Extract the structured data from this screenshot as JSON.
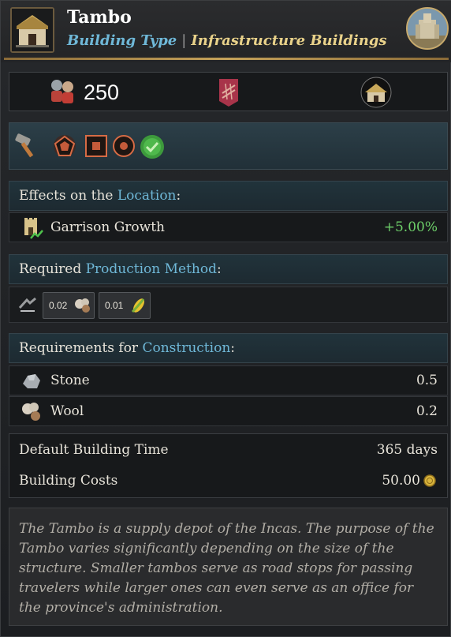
{
  "header": {
    "title": "Tambo",
    "type_label": "Building Type",
    "separator": "|",
    "category": "Infrastructure Buildings",
    "icon": "tambo-building-icon",
    "portrait_icon": "castle-portrait-icon"
  },
  "stats": {
    "population_icon": "pops-icon",
    "population": "250",
    "road_icon": "road-icon",
    "building_icon": "hut-icon"
  },
  "tech": {
    "icons": [
      "hammer-icon",
      "pentagon-icon",
      "square-icon",
      "circle-icon",
      "checkmark-icon"
    ]
  },
  "effects": {
    "header_prefix": "Effects on the ",
    "header_link": "Location",
    "header_suffix": ":",
    "rows": [
      {
        "icon": "garrison-icon",
        "label": "Garrison Growth",
        "value": "+5.00%"
      }
    ]
  },
  "production": {
    "header_prefix": "Required ",
    "header_link": "Production Method",
    "header_suffix": ":",
    "items": [
      {
        "amount": "0.02",
        "icon": "wool-icon"
      },
      {
        "amount": "0.01",
        "icon": "maize-icon"
      }
    ]
  },
  "construction": {
    "header_prefix": "Requirements for ",
    "header_link": "Construction",
    "header_suffix": ":",
    "rows": [
      {
        "icon": "stone-icon",
        "label": "Stone",
        "value": "0.5"
      },
      {
        "icon": "wool-icon",
        "label": "Wool",
        "value": "0.2"
      }
    ]
  },
  "info": {
    "time_label": "Default Building Time",
    "time_value": "365 days",
    "cost_label": "Building Costs",
    "cost_value": "50.00",
    "cost_icon": "gold-coin-icon"
  },
  "description": "The Tambo is a supply depot of the Incas. The purpose of the Tambo varies significantly depending on the size of the structure. Smaller tambos serve as road stops for passing travelers while larger ones can even serve as an office for the province's administration.",
  "colors": {
    "accent_blue": "#6fb8d8",
    "accent_gold": "#e9d28a",
    "positive_green": "#6ed06a"
  }
}
